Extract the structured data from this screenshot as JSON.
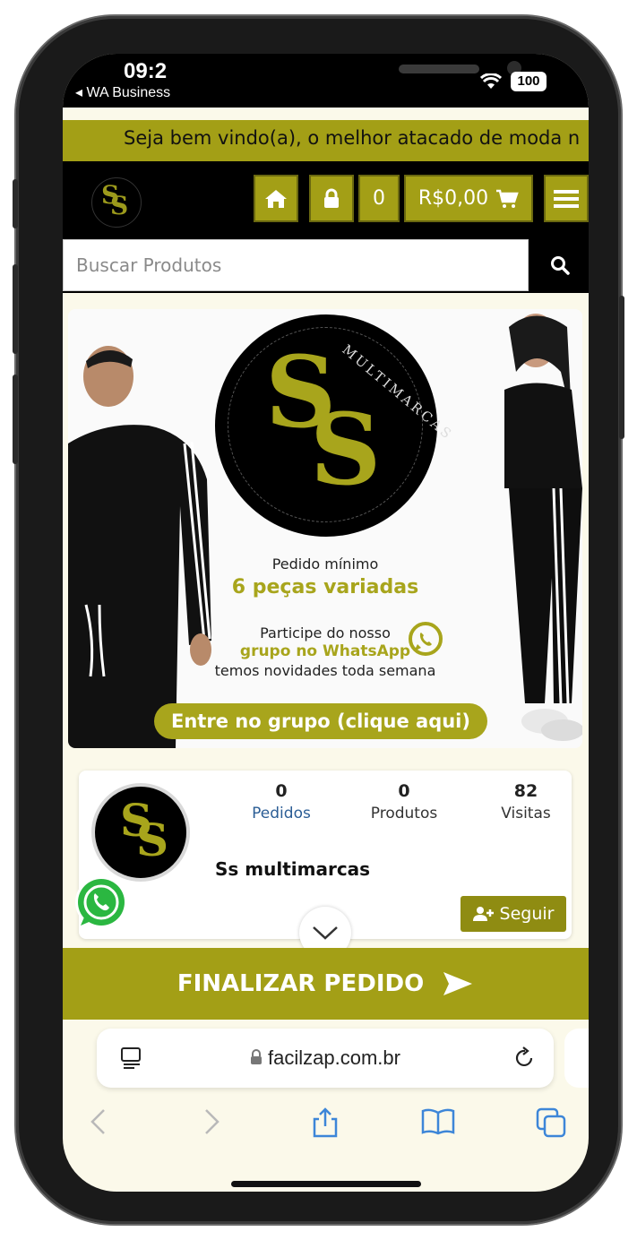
{
  "status_bar": {
    "time": "09:2",
    "back_app": "◂ WA Business",
    "battery": "100"
  },
  "marquee": {
    "text": "Seja bem vindo(a), o melhor atacado de moda n"
  },
  "header": {
    "cart_count": "0",
    "cart_total": "R$0,00"
  },
  "search": {
    "placeholder": "Buscar Produtos"
  },
  "banner": {
    "logo_letters": [
      "S",
      "S"
    ],
    "logo_brand": "MULTIMARCAS",
    "min_label": "Pedido mínimo",
    "min_value": "6 peças variadas",
    "join_line1": "Participe do nosso",
    "join_line2": "grupo no WhatsApp",
    "join_line3": "temos novidades toda semana",
    "cta": "Entre no grupo (clique aqui)"
  },
  "profile": {
    "stats": [
      {
        "value": "0",
        "label": "Pedidos"
      },
      {
        "value": "0",
        "label": "Produtos"
      },
      {
        "value": "82",
        "label": "Visitas"
      }
    ],
    "name": "Ss multimarcas",
    "follow_label": "Seguir"
  },
  "checkout": {
    "label": "FINALIZAR PEDIDO"
  },
  "browser": {
    "url": "facilzap.com.br"
  },
  "colors": {
    "accent": "#a39f16",
    "dark": "#000000",
    "link": "#2b5d95"
  }
}
